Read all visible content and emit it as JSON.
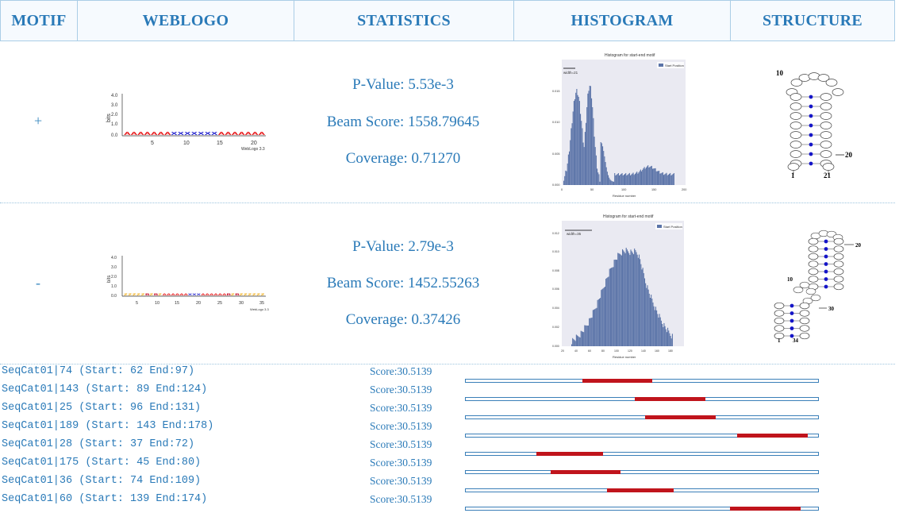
{
  "headers": [
    "MOTIF",
    "WEBLOGO",
    "STATISTICS",
    "HISTOGRAM",
    "STRUCTURE"
  ],
  "motifs": [
    {
      "sign": "+",
      "pvalue": "P-Value: 5.53e-3",
      "beam": "Beam Score: 1558.79645",
      "coverage": "Coverage: 0.71270",
      "logo": {
        "ylabel": "bits",
        "yticks": [
          "4.0",
          "3.0",
          "2.0",
          "1.0",
          "0.0"
        ],
        "xticks": [
          "5",
          "10",
          "15",
          "20"
        ],
        "credit": "WebLogo 3.3",
        "letters": "AAAAAAAXXXXXXXAAAAAAA"
      },
      "hist": {
        "title": "Histogram for start-end motif",
        "legend": "Start Position",
        "width_label": "width=21",
        "xlabel": "Residue number",
        "yticks": [
          "0.015",
          "0.010",
          "0.005",
          "0.000"
        ],
        "xticks": [
          "0",
          "50",
          "100",
          "150",
          "200"
        ]
      },
      "structure": {
        "labels": [
          "10",
          "20",
          "1",
          "21"
        ]
      }
    },
    {
      "sign": "-",
      "pvalue": "P-Value: 2.79e-3",
      "beam": "Beam Score: 1452.55263",
      "coverage": "Coverage: 0.37426",
      "logo": {
        "ylabel": "bits",
        "yticks": [
          "4.0",
          "3.0",
          "2.0",
          "1.0",
          "0.0"
        ],
        "xticks": [
          "5",
          "10",
          "15",
          "20",
          "25",
          "30",
          "35"
        ],
        "credit": "WebLogo 3.3",
        "letters": "ZZZZZBZBZAAAAAAXXXAAAAAABZBZZZZZZ"
      },
      "hist": {
        "title": "Histogram for start-end motif",
        "legend": "Start Position",
        "width_label": "width=35",
        "xlabel": "Residue number",
        "yticks": [
          "0.012",
          "0.010",
          "0.008",
          "0.006",
          "0.004",
          "0.002",
          "0.000"
        ],
        "xticks": [
          "20",
          "40",
          "60",
          "80",
          "100",
          "120",
          "140",
          "160",
          "180"
        ]
      },
      "structure": {
        "labels": [
          "20",
          "10",
          "30",
          "1",
          "34"
        ]
      }
    }
  ],
  "sequences": [
    {
      "id": "SeqCat01|74 (Start: 62 End:97)",
      "score": "Score:30.5139",
      "start_frac": 0.33,
      "end_frac": 0.53
    },
    {
      "id": "SeqCat01|143 (Start: 89 End:124)",
      "score": "Score:30.5139",
      "start_frac": 0.48,
      "end_frac": 0.68
    },
    {
      "id": "SeqCat01|25 (Start: 96 End:131)",
      "score": "Score:30.5139",
      "start_frac": 0.51,
      "end_frac": 0.71
    },
    {
      "id": "SeqCat01|189 (Start: 143 End:178)",
      "score": "Score:30.5139",
      "start_frac": 0.77,
      "end_frac": 0.97
    },
    {
      "id": "SeqCat01|28 (Start: 37 End:72)",
      "score": "Score:30.5139",
      "start_frac": 0.2,
      "end_frac": 0.39
    },
    {
      "id": "SeqCat01|175 (Start: 45 End:80)",
      "score": "Score:30.5139",
      "start_frac": 0.24,
      "end_frac": 0.44
    },
    {
      "id": "SeqCat01|36 (Start: 74 End:109)",
      "score": "Score:30.5139",
      "start_frac": 0.4,
      "end_frac": 0.59
    },
    {
      "id": "SeqCat01|60 (Start: 139 End:174)",
      "score": "Score:30.5139",
      "start_frac": 0.75,
      "end_frac": 0.95
    }
  ],
  "colors": {
    "header_text": "#2a7ab8",
    "hit": "#c0141c",
    "hist_bar": "#5b74a8",
    "logo_A": "#e8191b",
    "logo_X": "#1a1acd",
    "logo_Z": "#f0a500"
  }
}
